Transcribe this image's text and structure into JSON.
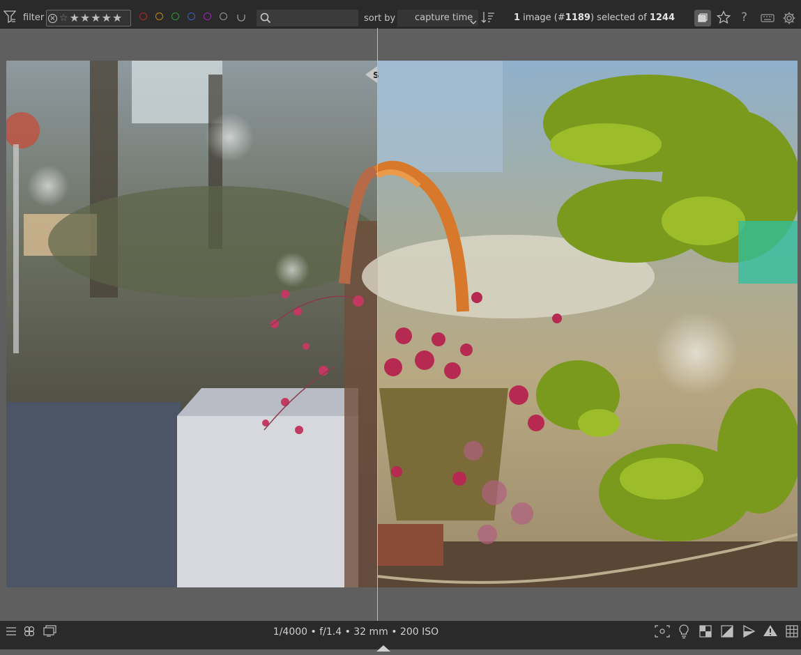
{
  "topbar": {
    "filter_label": "filter",
    "sort_label": "sort by",
    "sort_value": "capture time",
    "search_placeholder": "",
    "status": {
      "count": "1",
      "text_image": " image (#",
      "image_id": "1189",
      "text_selected": ") selected of ",
      "total": "1244"
    },
    "stars": [
      "★",
      "★",
      "★",
      "★",
      "★"
    ],
    "color_labels": [
      "#b02a2a",
      "#c08a1a",
      "#2e9a3a",
      "#3a62c0",
      "#9a2ab0",
      "#9a9a9a"
    ],
    "icons": [
      "filter-icon",
      "reject-icon",
      "search-icon",
      "sort-order-icon",
      "grouping-icon",
      "star-icon",
      "help-icon",
      "keyboard-icon",
      "settings-icon"
    ]
  },
  "viewer": {
    "split_marker": "S"
  },
  "bottombar": {
    "exif": "1/4000 • f/1.4 • 32 mm • 200 ISO",
    "icons": [
      "menu-icon",
      "styles-icon",
      "second-window-icon",
      "focus-peaking-icon",
      "lightbulb-icon",
      "softproof-icon",
      "gamut-check-icon",
      "overexposed-icon",
      "warning-icon",
      "guides-icon",
      "expand-arrow-icon"
    ]
  }
}
